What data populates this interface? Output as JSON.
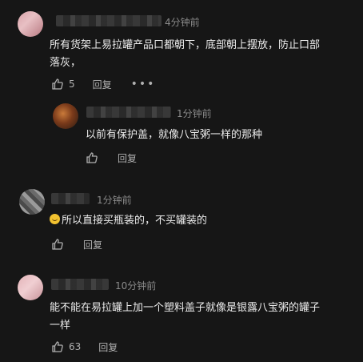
{
  "colors": {
    "background": "#161616",
    "text": "#ececec",
    "meta": "#8a8a8a"
  },
  "comments": [
    {
      "time": "4分钟前",
      "text_line1": "所有货架上易拉罐产品口都朝下，底部朝上摆放，防止口部",
      "text_line2": "落灰，",
      "likes": "5",
      "reply_label": "回复",
      "more_label": "•••"
    },
    {
      "time": "1分钟前",
      "text": "以前有保护盖，就像八宝粥一样的那种",
      "reply_label": "回复"
    },
    {
      "time": "1分钟前",
      "text": "所以直接买瓶装的，不买罐装的",
      "reply_label": "回复"
    },
    {
      "time": "10分钟前",
      "text_line1": "能不能在易拉罐上加一个塑料盖子就像是银露八宝粥的罐子",
      "text_line2": "一样",
      "likes": "63",
      "reply_label": "回复"
    }
  ]
}
